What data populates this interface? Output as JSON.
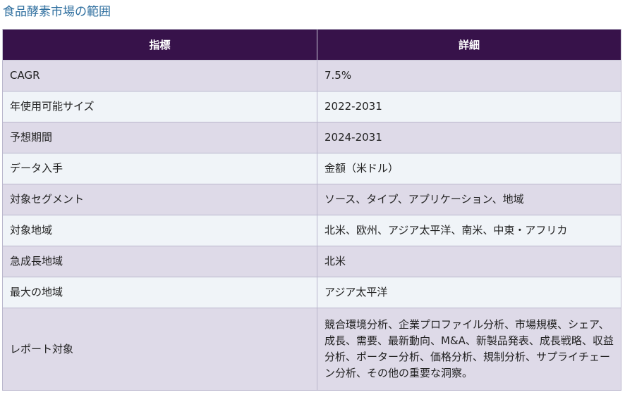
{
  "page": {
    "title": "食品酵素市場の範囲"
  },
  "table": {
    "headers": [
      "指標",
      "詳細"
    ],
    "rows": [
      {
        "metric": "CAGR",
        "detail": "7.5%"
      },
      {
        "metric": "年使用可能サイズ",
        "detail": "2022-2031"
      },
      {
        "metric": "予想期間",
        "detail": "2024-2031"
      },
      {
        "metric": "データ入手",
        "detail": "金額（米ドル）"
      },
      {
        "metric": "対象セグメント",
        "detail": "ソース、タイプ、アプリケーション、地域"
      },
      {
        "metric": "対象地域",
        "detail": "北米、欧州、アジア太平洋、南米、中東・アフリカ"
      },
      {
        "metric": "急成長地域",
        "detail": "北米"
      },
      {
        "metric": "最大の地域",
        "detail": "アジア太平洋"
      },
      {
        "metric": "レポート対象",
        "detail": "競合環境分析、企業プロファイル分析、市場規模、シェア、成長、需要、最新動向、M&A、新製品発表、成長戦略、収益分析、ポーター分析、価格分析、規制分析、サプライチェーン分析、その他の重要な洞察。"
      }
    ]
  },
  "colors": {
    "title": "#2f6f9f",
    "header_bg": "#37124a",
    "row_odd_bg": "#dedae8",
    "row_even_bg": "#f0f4f8"
  }
}
